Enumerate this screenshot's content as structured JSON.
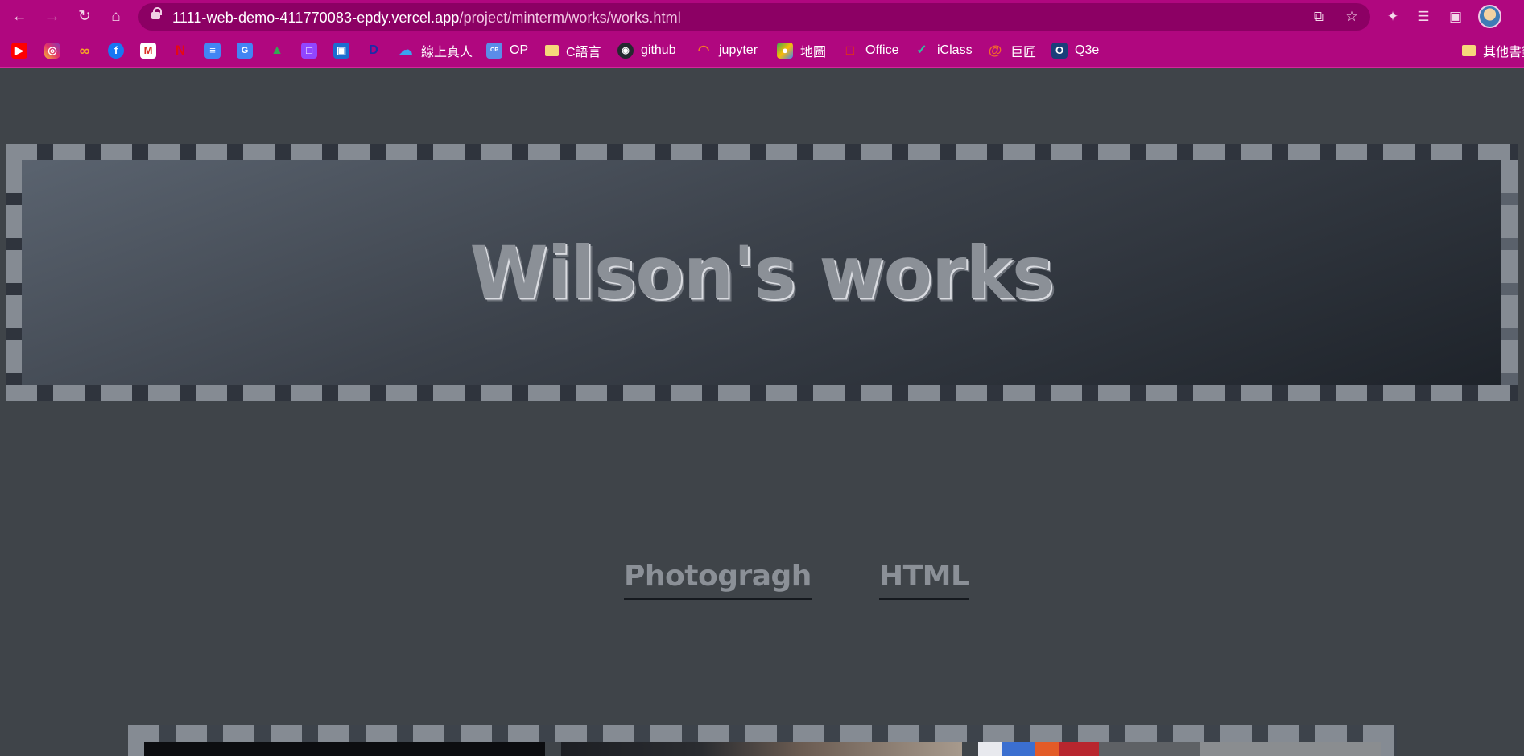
{
  "browser": {
    "url_host": "1111-web-demo-411770083-epdy.vercel.app",
    "url_path": "/project/minterm/works/works.html",
    "nav_icons": [
      "back-icon",
      "forward-icon",
      "reload-icon",
      "home-icon"
    ],
    "omnibox_icons": [
      "share-icon",
      "star-icon"
    ],
    "toolbar_icons": [
      "extensions-icon",
      "media-queue-icon",
      "side-panel-icon"
    ],
    "accent_color": "#b0077f"
  },
  "bookmarks": {
    "items": [
      {
        "icon": "youtube-icon",
        "label": ""
      },
      {
        "icon": "instagram-icon",
        "label": ""
      },
      {
        "icon": "infinity-icon",
        "label": ""
      },
      {
        "icon": "facebook-icon",
        "label": ""
      },
      {
        "icon": "gmail-icon",
        "label": ""
      },
      {
        "icon": "netflix-icon",
        "label": ""
      },
      {
        "icon": "google-docs-icon",
        "label": ""
      },
      {
        "icon": "translate-icon",
        "label": ""
      },
      {
        "icon": "google-drive-icon",
        "label": ""
      },
      {
        "icon": "twitch-icon",
        "label": ""
      },
      {
        "icon": "app-icon",
        "label": ""
      },
      {
        "icon": "disney-icon",
        "label": ""
      },
      {
        "icon": "cloud-icon",
        "label": "線上真人"
      },
      {
        "icon": "op-icon",
        "label": "OP"
      },
      {
        "icon": "folder-icon",
        "label": "C語言"
      },
      {
        "icon": "github-icon",
        "label": "github"
      },
      {
        "icon": "jupyter-icon",
        "label": "jupyter"
      },
      {
        "icon": "maps-icon",
        "label": "地圖"
      },
      {
        "icon": "office-icon",
        "label": "Office"
      },
      {
        "icon": "iclass-icon",
        "label": "iClass"
      },
      {
        "icon": "spiral-icon",
        "label": "巨匠"
      },
      {
        "icon": "q3e-icon",
        "label": "Q3e"
      }
    ],
    "other_label": "其他書籤"
  },
  "page": {
    "title": "Wilson's works",
    "nav": [
      {
        "label": "Photogragh"
      },
      {
        "label": "HTML"
      }
    ],
    "background_color": "#3f4449"
  }
}
